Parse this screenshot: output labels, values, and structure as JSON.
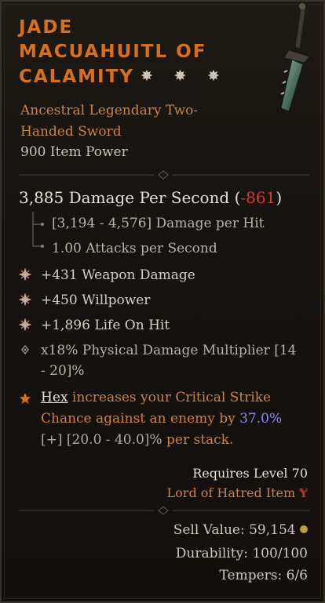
{
  "item": {
    "name_lines": [
      "JADE",
      "MACUAHUITL OF",
      "CALAMITY"
    ],
    "masterwork_stars": "✸ ✸ ✸",
    "type_line1": "Ancestral Legendary Two-",
    "type_line2": "Handed Sword",
    "item_power": "900 Item Power"
  },
  "damage": {
    "dps": "3,885 Damage Per Second",
    "dps_delta": "-861",
    "per_hit": "[3,194 - 4,576] Damage per Hit",
    "attack_speed": "1.00 Attacks per Second"
  },
  "affixes": [
    "+431 Weapon Damage",
    "+450 Willpower",
    "+1,896 Life On Hit"
  ],
  "tempered": {
    "line1": "x18% Physical Damage Multiplier [14",
    "line2": "- 20]%"
  },
  "legendary": {
    "skill": "Hex",
    "text_a": " increases your Critical Strike",
    "text_b": "Chance against an enemy by ",
    "value": "37.0%",
    "range": "[+] [20.0 - 40.0]%",
    "text_c": " per stack."
  },
  "requirements": {
    "level": "Requires Level 70",
    "expansion": "Lord of Hatred Item"
  },
  "footer": {
    "sell_value": "Sell Value: 59,154",
    "durability": "Durability: 100/100",
    "tempers": "Tempers: 6/6"
  },
  "colors": {
    "title": "#d7701c",
    "legendary_text": "#d0823a",
    "negative": "#d63a2e",
    "value_blue": "#8a8af0"
  }
}
